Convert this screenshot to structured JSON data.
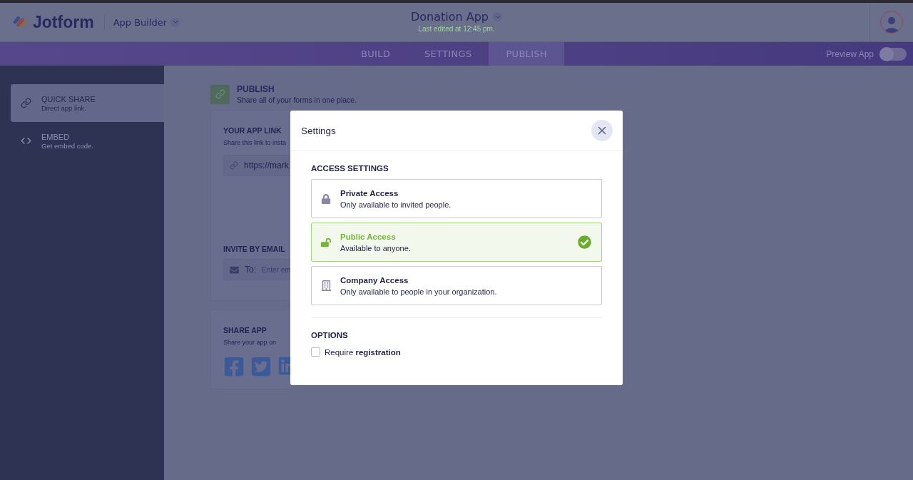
{
  "header": {
    "logo": "Jotform",
    "product_menu": "App Builder",
    "app_title": "Donation App",
    "last_edited": "Last edited at 12:45 pm."
  },
  "nav": {
    "tabs": [
      {
        "label": "BUILD",
        "selected": false
      },
      {
        "label": "SETTINGS",
        "selected": false
      },
      {
        "label": "PUBLISH",
        "selected": true
      }
    ],
    "preview": {
      "label": "Preview App",
      "on": false
    }
  },
  "sidebar": {
    "items": [
      {
        "kind": "link",
        "title": "QUICK SHARE",
        "subtitle": "Direct app link.",
        "selected": true
      },
      {
        "kind": "embed",
        "title": "EMBED",
        "subtitle": "Get embed code.",
        "selected": false
      }
    ]
  },
  "publish": {
    "title": "PUBLISH",
    "subtitle": "Share all of your forms in one place."
  },
  "app_link": {
    "title": "YOUR APP LINK",
    "description": "Share this link to insta",
    "url": "https://mark"
  },
  "invite": {
    "title": "INVITE BY EMAIL",
    "to_label": "To:",
    "placeholder": "Enter em"
  },
  "share": {
    "title": "SHARE APP",
    "description": "Share your app on",
    "networks": [
      {
        "kind": "facebook"
      },
      {
        "kind": "twitter"
      },
      {
        "kind": "linkedin"
      }
    ]
  },
  "modal": {
    "title": "Settings",
    "access_heading": "ACCESS SETTINGS",
    "access_options": [
      {
        "kind": "private",
        "title": "Private Access",
        "description": "Only available to invited people.",
        "selected": false
      },
      {
        "kind": "public",
        "title": "Public Access",
        "description": "Available to anyone.",
        "selected": true
      },
      {
        "kind": "company",
        "title": "Company Access",
        "description": "Only available to people in your organization.",
        "selected": false
      }
    ],
    "options_heading": "OPTIONS",
    "require_registration": {
      "label": "Require **registration**",
      "checked": false
    }
  }
}
